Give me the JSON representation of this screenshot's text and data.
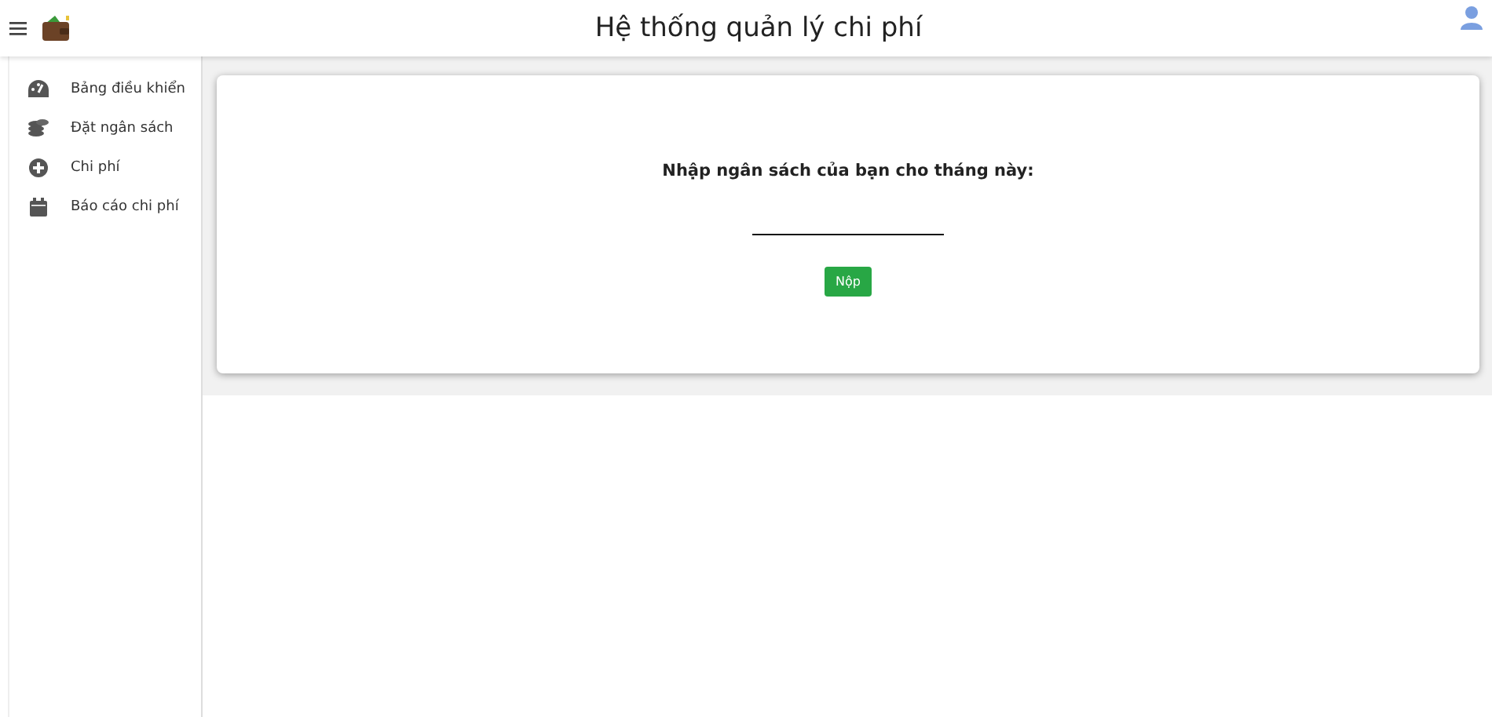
{
  "header": {
    "title": "Hệ thống quản lý chi phí"
  },
  "sidebar": {
    "items": [
      {
        "label": "Bảng điều khiển"
      },
      {
        "label": "Đặt ngân sách"
      },
      {
        "label": "Chi phí"
      },
      {
        "label": "Báo cáo chi phí"
      }
    ]
  },
  "form": {
    "prompt": "Nhập ngân sách của bạn cho tháng này:",
    "submit": "Nộp"
  }
}
